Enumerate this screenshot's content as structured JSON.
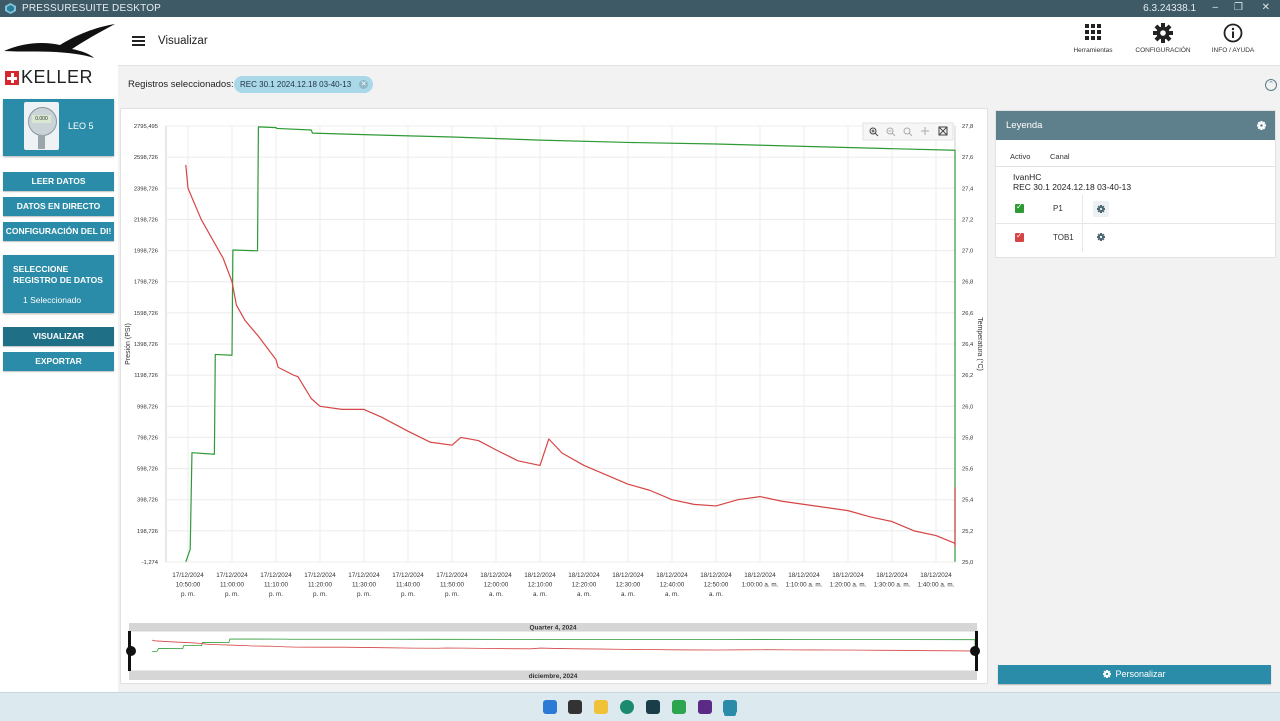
{
  "window": {
    "app_name": "PRESSURESUITE DESKTOP",
    "version": "6.3.24338.1"
  },
  "sidebar": {
    "brand": "KELLER",
    "device_name": "LEO 5",
    "device_display": "0.000",
    "buttons": [
      "LEER DATOS",
      "DATOS EN DIRECTO",
      "CONFIGURACIÓN DEL DI!"
    ],
    "select_title": "SELECCIONE REGISTRO DE DATOS",
    "select_count": "1 Seleccionado",
    "visualize": "VISUALIZAR",
    "export": "EXPORTAR"
  },
  "header": {
    "title": "Visualizar",
    "tools": [
      {
        "label": "Herramientas",
        "icon": "grid-icon"
      },
      {
        "label": "CONFIGURACIÓN",
        "icon": "gear-icon"
      },
      {
        "label": "INFO / AYUDA",
        "icon": "info-icon"
      }
    ]
  },
  "selection": {
    "label": "Registros seleccionados:",
    "chip": "REC 30.1 2024.12.18 03-40-13"
  },
  "legend": {
    "title": "Leyenda",
    "col_active": "Activo",
    "col_channel": "Canal",
    "user": "IvanHC",
    "record": "REC 30.1 2024.12.18 03-40-13",
    "channels": [
      {
        "name": "P1",
        "color": "#2e9a36",
        "active": true
      },
      {
        "name": "TOB1",
        "color": "#d64545",
        "active": true
      }
    ]
  },
  "customize_button": "Personalizar",
  "chart_data": {
    "type": "line",
    "ylabel": "Presión (PSI)",
    "y2label": "Temperatura (°C)",
    "y_ticks": [
      "-1,274",
      "198,726",
      "398,726",
      "598,726",
      "798,726",
      "998,726",
      "1198,726",
      "1398,726",
      "1598,726",
      "1798,726",
      "1998,726",
      "2198,726",
      "2398,726",
      "2598,726",
      "2795,495"
    ],
    "y2_ticks": [
      "25,0",
      "25,2",
      "25,4",
      "25,6",
      "25,8",
      "26,0",
      "26,2",
      "26,4",
      "26,6",
      "26,8",
      "27,0",
      "27,2",
      "27,4",
      "27,6",
      "27,8"
    ],
    "ylim": [
      -1.274,
      2795.495
    ],
    "y2lim": [
      25.0,
      27.8
    ],
    "x_ticks": [
      [
        "17/12/2024",
        "10:50:00",
        "p. m."
      ],
      [
        "17/12/2024",
        "11:00:00",
        "p. m."
      ],
      [
        "17/12/2024",
        "11:10:00",
        "p. m."
      ],
      [
        "17/12/2024",
        "11:20:00",
        "p. m."
      ],
      [
        "17/12/2024",
        "11:30:00",
        "p. m."
      ],
      [
        "17/12/2024",
        "11:40:00",
        "p. m."
      ],
      [
        "17/12/2024",
        "11:50:00",
        "p. m."
      ],
      [
        "18/12/2024",
        "12:00:00",
        "a. m."
      ],
      [
        "18/12/2024",
        "12:10:00",
        "a. m."
      ],
      [
        "18/12/2024",
        "12:20:00",
        "a. m."
      ],
      [
        "18/12/2024",
        "12:30:00",
        "a. m."
      ],
      [
        "18/12/2024",
        "12:40:00",
        "a. m."
      ],
      [
        "18/12/2024",
        "12:50:00",
        "a. m."
      ],
      [
        "18/12/2024",
        "1:00:00 a. m."
      ],
      [
        "18/12/2024",
        "1:10:00 a. m."
      ],
      [
        "18/12/2024",
        "1:20:00 a. m."
      ],
      [
        "18/12/2024",
        "1:30:00 a. m."
      ],
      [
        "18/12/2024",
        "1:40:00 a. m."
      ]
    ],
    "grid": true,
    "navigator_top_label": "Quarter 4, 2024",
    "navigator_bottom_label": "diciembre, 2024",
    "series": [
      {
        "name": "P1",
        "axis": "left",
        "color": "#2e9a36",
        "x": [
          -0.05,
          0.05,
          0.09,
          0.6,
          0.62,
          1.0,
          1.02,
          1.58,
          1.6,
          2.0,
          2.02,
          2.8,
          2.83,
          4.0,
          6.0,
          8.0,
          10.0,
          12.0,
          14.0,
          16.0,
          17.5,
          17.65,
          17.75
        ],
        "y": [
          0,
          80,
          700,
          690,
          1330,
          1325,
          2000,
          1995,
          2790,
          2785,
          2780,
          2770,
          2750,
          2740,
          2725,
          2705,
          2690,
          2680,
          2665,
          2650,
          2640,
          900,
          0
        ]
      },
      {
        "name": "TOB1",
        "axis": "right",
        "color": "#d64545",
        "x": [
          -0.05,
          0.0,
          0.3,
          0.8,
          1.0,
          1.1,
          1.3,
          1.6,
          2.0,
          2.05,
          2.4,
          2.5,
          2.8,
          3.0,
          3.5,
          4.0,
          4.4,
          5.0,
          5.5,
          6.0,
          6.2,
          6.6,
          7.0,
          7.5,
          8.0,
          8.2,
          8.5,
          9.0,
          9.5,
          10.0,
          10.5,
          11.0,
          11.5,
          12.0,
          12.5,
          13.0,
          13.5,
          14.0,
          14.5,
          15.0,
          15.5,
          16.0,
          16.5,
          17.0,
          17.5,
          17.75,
          17.85
        ],
        "y": [
          27.55,
          27.4,
          27.2,
          26.95,
          26.8,
          26.65,
          26.55,
          26.45,
          26.3,
          26.25,
          26.2,
          26.19,
          26.05,
          26.0,
          25.98,
          25.98,
          25.93,
          25.84,
          25.77,
          25.75,
          25.8,
          25.78,
          25.72,
          25.65,
          25.62,
          25.79,
          25.7,
          25.62,
          25.56,
          25.5,
          25.46,
          25.4,
          25.37,
          25.36,
          25.4,
          25.42,
          25.39,
          25.37,
          25.35,
          25.33,
          25.29,
          25.26,
          25.2,
          25.17,
          25.12,
          25.1,
          25.48
        ]
      }
    ]
  }
}
